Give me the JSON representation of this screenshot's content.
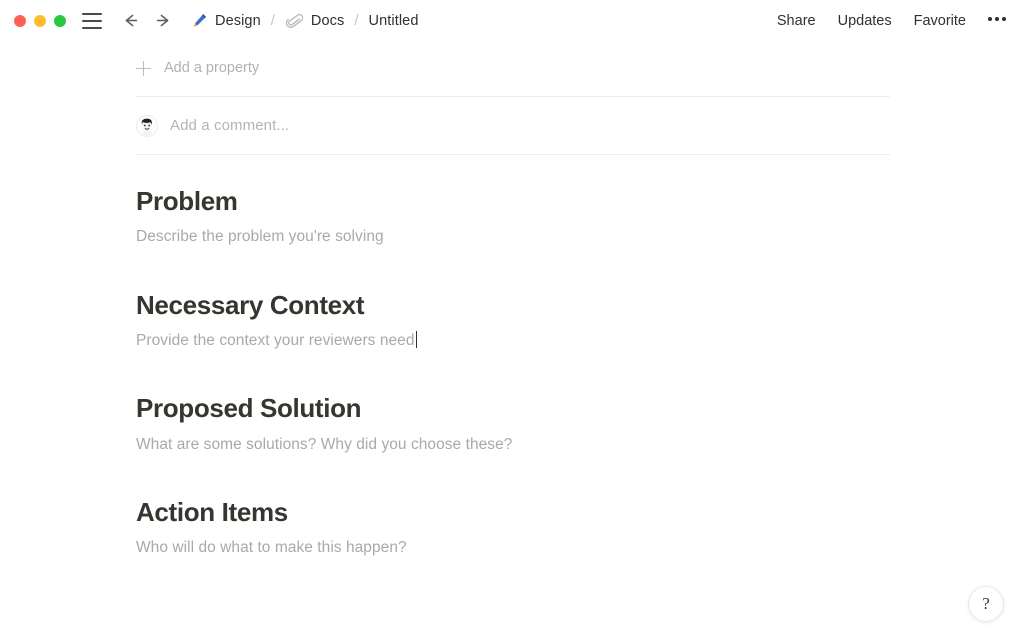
{
  "window": {
    "traffic_lights": [
      {
        "name": "close",
        "color": "#ff5f57"
      },
      {
        "name": "minimize",
        "color": "#ffbd2e"
      },
      {
        "name": "maximize",
        "color": "#28c840"
      }
    ],
    "menu_icon": "hamburger-icon",
    "back_icon": "arrow-left-icon",
    "forward_icon": "arrow-right-icon"
  },
  "breadcrumb": {
    "separator": "/",
    "items": [
      {
        "icon": "pen-icon",
        "label": "Design"
      },
      {
        "icon": "paperclip-icon",
        "label": "Docs"
      },
      {
        "icon": "",
        "label": "Untitled"
      }
    ]
  },
  "titlebar_actions": {
    "share": "Share",
    "updates": "Updates",
    "favorite": "Favorite",
    "more": "•••"
  },
  "properties": {
    "add_label": "Add a property",
    "add_icon": "plus-icon"
  },
  "comment": {
    "avatar": "user-avatar",
    "placeholder": "Add a comment..."
  },
  "document": {
    "sections": [
      {
        "heading": "Problem",
        "placeholder": "Describe the problem you're solving",
        "has_caret": false
      },
      {
        "heading": "Necessary Context",
        "placeholder": "Provide the context your reviewers need",
        "has_caret": true
      },
      {
        "heading": "Proposed Solution",
        "placeholder": "What are some solutions? Why did you choose these?",
        "has_caret": false
      },
      {
        "heading": "Action Items",
        "placeholder": "Who will do what to make this happen?",
        "has_caret": false
      }
    ]
  },
  "help": {
    "label": "?",
    "icon": "question-mark-icon"
  },
  "colors": {
    "heading_text": "#36352f",
    "placeholder_text": "#a9a9ab",
    "divider": "#ededee",
    "titlebar_text": "#303033"
  }
}
